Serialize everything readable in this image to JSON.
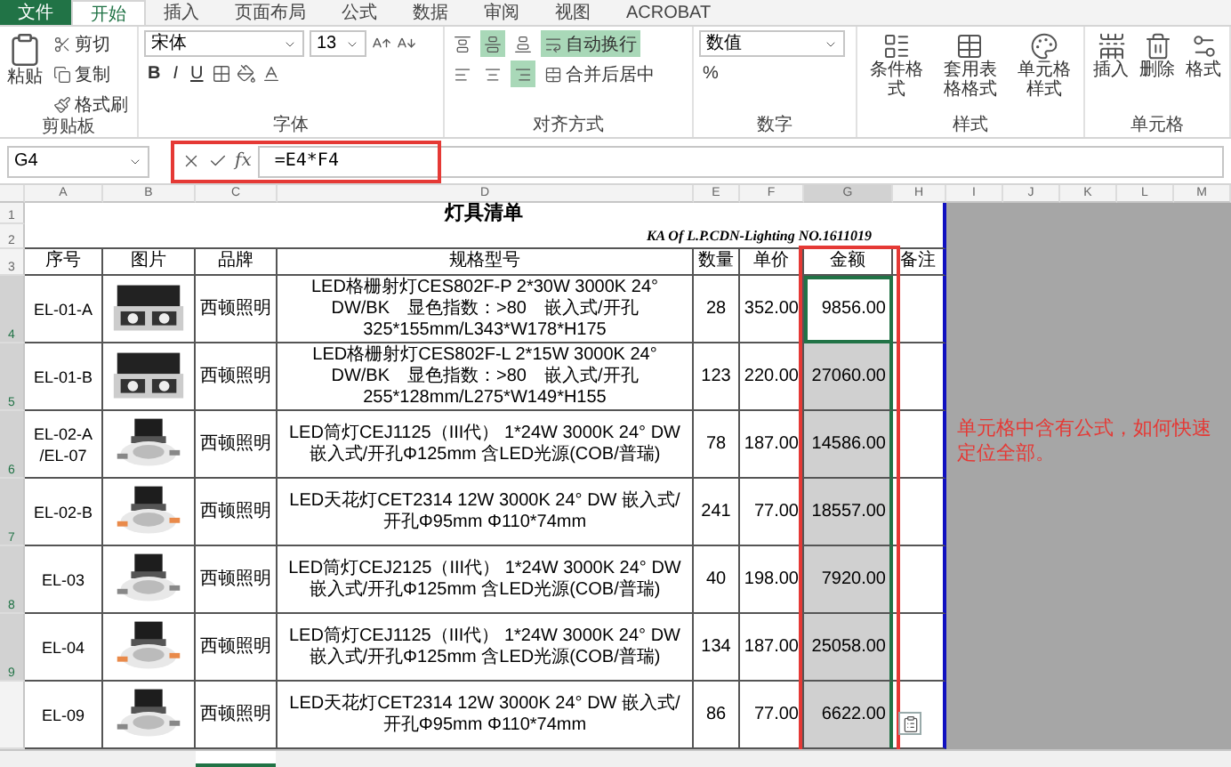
{
  "tabs": [
    {
      "label": "文件",
      "kind": "file",
      "selected": false
    },
    {
      "label": "开始",
      "kind": "tab",
      "selected": true
    },
    {
      "label": "插入",
      "kind": "tab",
      "selected": false
    },
    {
      "label": "页面布局",
      "kind": "tab",
      "selected": false
    },
    {
      "label": "公式",
      "kind": "tab",
      "selected": false
    },
    {
      "label": "数据",
      "kind": "tab",
      "selected": false
    },
    {
      "label": "审阅",
      "kind": "tab",
      "selected": false
    },
    {
      "label": "视图",
      "kind": "tab",
      "selected": false
    },
    {
      "label": "ACROBAT",
      "kind": "tab",
      "selected": false
    }
  ],
  "ribbon": {
    "clipboard": {
      "label": "剪贴板",
      "paste": "粘贴",
      "items": [
        "剪切",
        "复制",
        "格式刷"
      ]
    },
    "font": {
      "label": "字体",
      "name": "宋体",
      "size": "13",
      "buttons": [
        "B",
        "I",
        "U"
      ]
    },
    "alignment": {
      "label": "对齐方式",
      "wrap": "自动换行",
      "wrap_on": true,
      "merge": "合并后居中",
      "buttons": [
        {
          "kind": "top",
          "selected": false
        },
        {
          "kind": "middle",
          "selected": true
        },
        {
          "kind": "bottom",
          "selected": false
        },
        {
          "kind": "left",
          "selected": false
        },
        {
          "kind": "center",
          "selected": false
        },
        {
          "kind": "right",
          "selected": true
        }
      ]
    },
    "number": {
      "label": "数字",
      "format": "数值",
      "percent": "%"
    },
    "styles": {
      "label": "样式",
      "items": [
        "条件格式",
        "套用表格格式",
        "单元格样式"
      ]
    },
    "cells": {
      "label": "单元格",
      "items": [
        "插入",
        "删除",
        "格式"
      ]
    }
  },
  "formula_bar": {
    "name_box": "G4",
    "fx": "fx",
    "formula": "=E4*F4"
  },
  "columns": [
    {
      "label": "A",
      "selected": false
    },
    {
      "label": "B",
      "selected": false
    },
    {
      "label": "C",
      "selected": false
    },
    {
      "label": "D",
      "selected": false
    },
    {
      "label": "E",
      "selected": false
    },
    {
      "label": "F",
      "selected": false
    },
    {
      "label": "G",
      "selected": true
    },
    {
      "label": "H",
      "selected": false
    },
    {
      "label": "I",
      "selected": false
    },
    {
      "label": "J",
      "selected": false
    },
    {
      "label": "K",
      "selected": false
    },
    {
      "label": "L",
      "selected": false
    },
    {
      "label": "M",
      "selected": false
    }
  ],
  "row_headers": [
    {
      "label": "1",
      "selected": false
    },
    {
      "label": "2",
      "selected": false
    },
    {
      "label": "3",
      "selected": false
    },
    {
      "label": "4",
      "selected": true
    },
    {
      "label": "5",
      "selected": true
    },
    {
      "label": "6",
      "selected": true
    },
    {
      "label": "7",
      "selected": true
    },
    {
      "label": "8",
      "selected": true
    },
    {
      "label": "9",
      "selected": true
    }
  ],
  "sheet": {
    "title": "灯具清单",
    "subtitle": "KA Of L.P.CDN-Lighting NO.1611019",
    "headers": [
      "序号",
      "图片",
      "品牌",
      "规格型号",
      "数量",
      "单价",
      "金额",
      "备注"
    ],
    "rows": [
      {
        "id": "EL-01-A",
        "brand": "西顿照明",
        "spec": "LED格栅射灯CES802F-P 2*30W 3000K 24° DW/BK　显色指数：>80　嵌入式/开孔325*155mm/L343*W178*H175",
        "qty": "28",
        "price": "352.00",
        "amount": "9856.00",
        "selected": true,
        "active": true
      },
      {
        "id": "EL-01-B",
        "brand": "西顿照明",
        "spec": "LED格栅射灯CES802F-L 2*15W 3000K 24° DW/BK　显色指数：>80　嵌入式/开孔255*128mm/L275*W149*H155",
        "qty": "123",
        "price": "220.00",
        "amount": "27060.00",
        "selected": true,
        "active": false
      },
      {
        "id": "EL-02-A /EL-07",
        "brand": "西顿照明",
        "spec": "LED筒灯CEJ1125（III代） 1*24W 3000K 24° DW　嵌入式/开孔Φ125mm 含LED光源(COB/普瑞)",
        "qty": "78",
        "price": "187.00",
        "amount": "14586.00",
        "selected": true,
        "active": false
      },
      {
        "id": "EL-02-B",
        "brand": "西顿照明",
        "spec": "LED天花灯CET2314 12W 3000K 24° DW 嵌入式/开孔Φ95mm Φ110*74mm",
        "qty": "241",
        "price": "77.00",
        "amount": "18557.00",
        "selected": true,
        "active": false
      },
      {
        "id": "EL-03",
        "brand": "西顿照明",
        "spec": "LED筒灯CEJ2125（III代） 1*24W 3000K 24° DW　嵌入式/开孔Φ125mm 含LED光源(COB/普瑞)",
        "qty": "40",
        "price": "198.00",
        "amount": "7920.00",
        "selected": true,
        "active": false
      },
      {
        "id": "EL-04",
        "brand": "西顿照明",
        "spec": "LED筒灯CEJ1125（III代） 1*24W 3000K 24° DW　嵌入式/开孔Φ125mm 含LED光源(COB/普瑞)",
        "qty": "134",
        "price": "187.00",
        "amount": "25058.00",
        "selected": true,
        "active": false
      },
      {
        "id": "EL-09",
        "brand": "西顿照明",
        "spec": "LED天花灯CET2314 12W 3000K 24° DW 嵌入式/开孔Φ95mm Φ110*74mm",
        "qty": "86",
        "price": "77.00",
        "amount": "6622.00",
        "selected": true,
        "active": false
      }
    ]
  },
  "annotation": "单元格中含有公式，如何快速定位全部。"
}
